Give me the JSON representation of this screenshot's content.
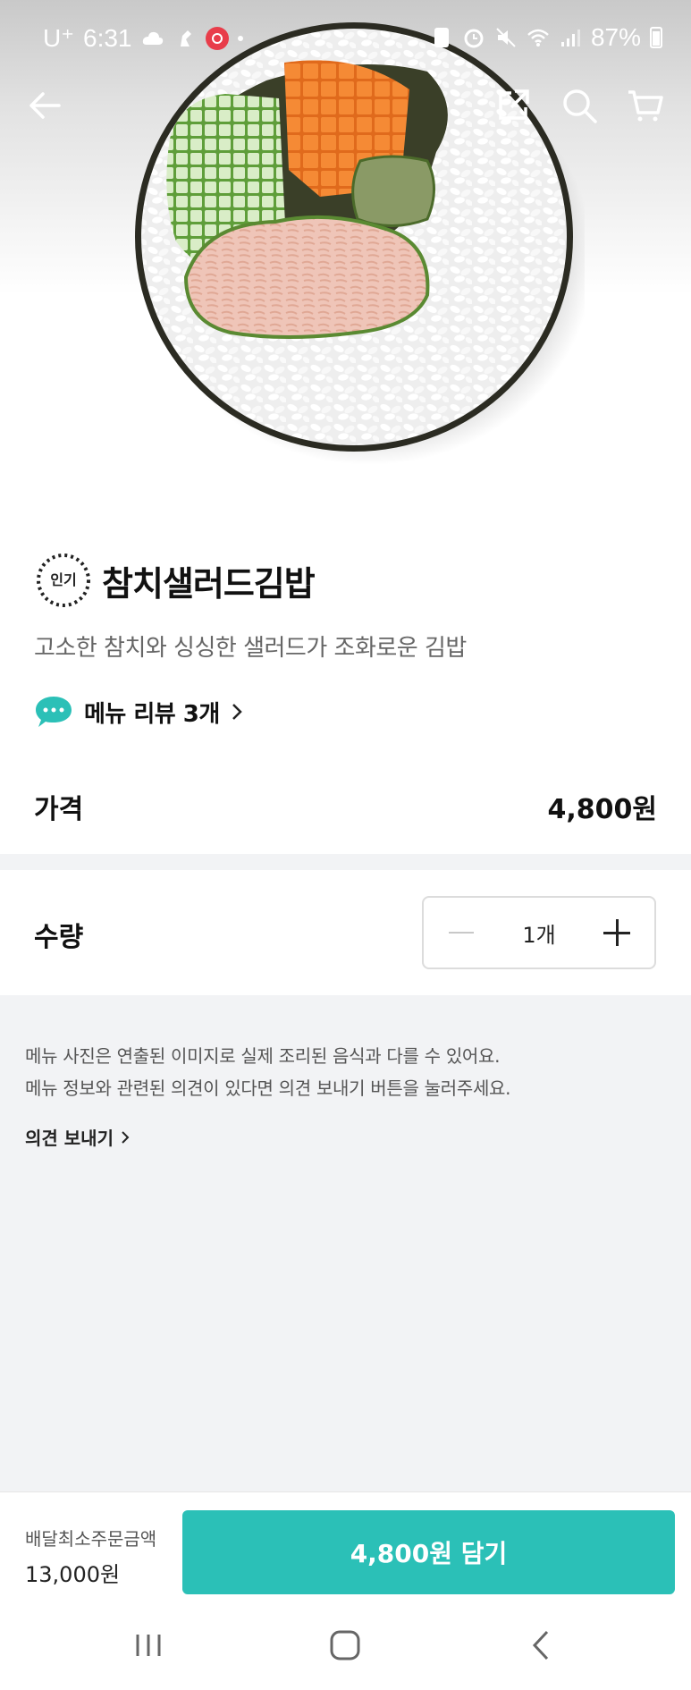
{
  "status_bar": {
    "carrier": "U⁺",
    "time": "6:31",
    "battery": "87%"
  },
  "header": {
    "icons": [
      "back-arrow-icon",
      "share-icon",
      "search-icon",
      "cart-icon"
    ]
  },
  "product": {
    "badge": "인기",
    "name": "참치샐러드김밥",
    "description": "고소한 참치와 싱싱한 샐러드가 조화로운 김밥",
    "review_link": "메뉴 리뷰 3개",
    "price_label": "가격",
    "price": "4,800원"
  },
  "quantity": {
    "label": "수량",
    "value": "1개"
  },
  "notice": {
    "line1": "메뉴 사진은 연출된 이미지로 실제 조리된 음식과 다를 수 있어요.",
    "line2": "메뉴 정보와 관련된 의견이 있다면 의견 보내기 버튼을 눌러주세요.",
    "feedback_link": "의견 보내기"
  },
  "bottom_bar": {
    "min_order_label": "배달최소주문금액",
    "min_order_value": "13,000원",
    "add_button": "4,800원 담기"
  },
  "colors": {
    "accent": "#2bc0b7",
    "page_gray": "#f2f3f5"
  }
}
